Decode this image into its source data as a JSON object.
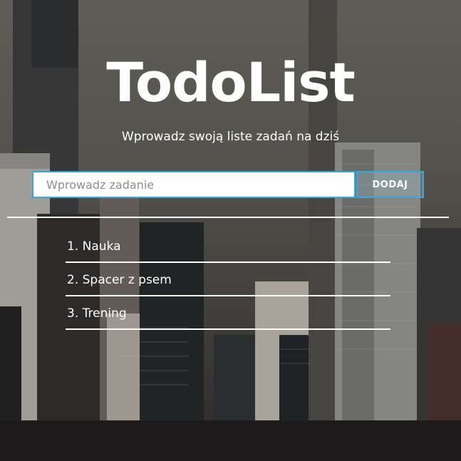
{
  "header": {
    "title": "TodoList",
    "subtitle": "Wprowadz swoją liste zadań na dziś"
  },
  "form": {
    "placeholder": "Wprowadz zadanie",
    "value": "",
    "button_label": "DODAJ"
  },
  "tasks": [
    {
      "label": "1. Nauka"
    },
    {
      "label": "2. Spacer z psem"
    },
    {
      "label": "3. Trening"
    }
  ],
  "colors": {
    "accent": "#36a9dc",
    "text": "#ffffff"
  }
}
